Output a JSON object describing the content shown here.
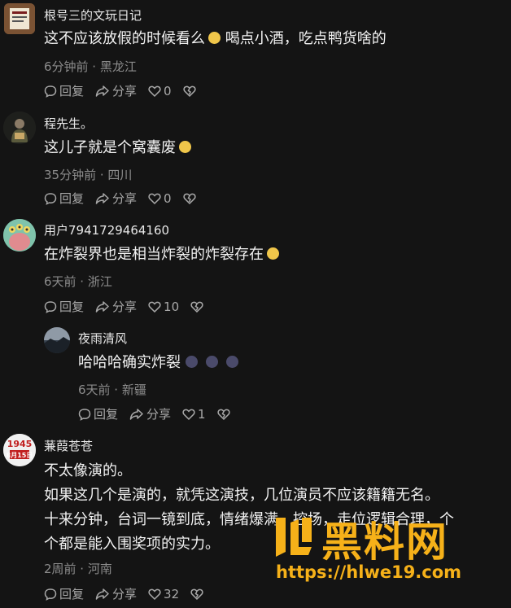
{
  "comments": [
    {
      "user": "根号三的文玩日记",
      "text": "这不应该放假的时候看么",
      "text_after": "喝点小酒，吃点鸭货啥的",
      "meta": "6分钟前 · 黑龙江",
      "reply_label": "回复",
      "share_label": "分享",
      "likes": "0"
    },
    {
      "user": "程先生。",
      "text": "这儿子就是个窝囊废",
      "meta": "35分钟前 · 四川",
      "reply_label": "回复",
      "share_label": "分享",
      "likes": "0"
    },
    {
      "user": "用户7941729464160",
      "text": "在炸裂界也是相当炸裂的炸裂存在",
      "meta": "6天前 · 浙江",
      "reply_label": "回复",
      "share_label": "分享",
      "likes": "10"
    },
    {
      "user": "夜雨清风",
      "text": "哈哈哈确实炸裂",
      "meta": "6天前 · 新疆",
      "reply_label": "回复",
      "share_label": "分享",
      "likes": "1"
    },
    {
      "user": "蒹葭苍苍",
      "avatar_text": "1945 8月15日",
      "lines": [
        "不太像演的。",
        "如果这几个是演的，就凭这演技，几位演员不应该籍籍无名。",
        "十来分钟，台词一镜到底，情绪爆满，控场，走位逻辑合理，个",
        "个都是能入围奖项的实力。"
      ],
      "meta": "2周前 · 河南",
      "reply_label": "回复",
      "share_label": "分享",
      "likes": "32"
    }
  ],
  "watermark": {
    "text": "黑料网",
    "url": "https://hlwe19.com",
    "color": "#f6b119"
  }
}
